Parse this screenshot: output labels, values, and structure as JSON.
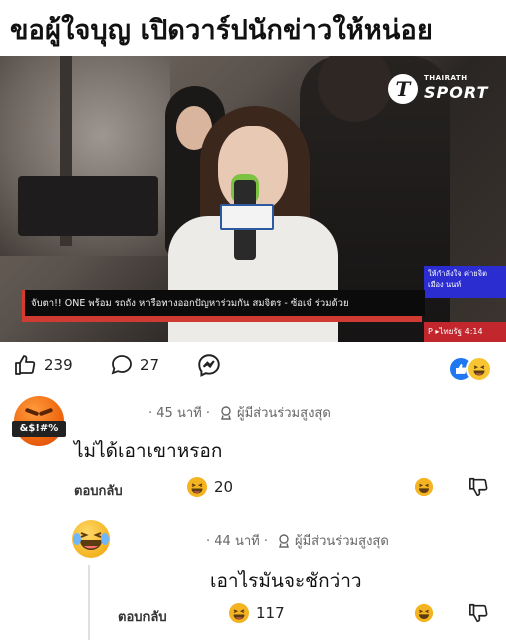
{
  "header": {
    "title": "ขอผู้ใจบุญ เปิดวาร์ปนักข่าวให้หน่อย"
  },
  "video": {
    "logo": {
      "brand": "THAIRATH",
      "name": "SPORT",
      "mark": "T"
    },
    "ticker": "จับตา!! ONE พร้อม รถถัง หารือทางออกปัญหาร่วมกัน สมจิตร - ซ้อเจ๋ ร่วมด้วย",
    "side_box": "ให้กำลังใจ ค่ายจิตเมือง นนท์",
    "live_tag": "P  ▸ไทยรัฐ 4:14"
  },
  "post_reactions": {
    "likes": "239",
    "comments": "27",
    "icons": [
      "like-icon",
      "comment-icon",
      "messenger-icon",
      "reaction-like-icon",
      "laughing-emoji-icon"
    ]
  },
  "comments": [
    {
      "avatar_icon": "angry-swearing-emoji-icon",
      "avatar_label": "&$!#%",
      "time": "· 45 นาที ·",
      "badge": "ผู้มีส่วนร่วมสูงสุด",
      "text": "ไม่ได้เอาเขาหรอก",
      "reply_label": "ตอบกลับ",
      "laugh_count": "20"
    },
    {
      "avatar_icon": "tears-of-joy-emoji-icon",
      "time": "· 44 นาที ·",
      "badge": "ผู้มีส่วนร่วมสูงสุด",
      "text": "เอาไรมันจะชักว่าว",
      "reply_label": "ตอบกลับ",
      "laugh_count": "117"
    }
  ],
  "colors": {
    "accent_blue": "#1f77f2",
    "ticker_red": "#cf3b32",
    "emoji_yellow": "#f4b320"
  }
}
